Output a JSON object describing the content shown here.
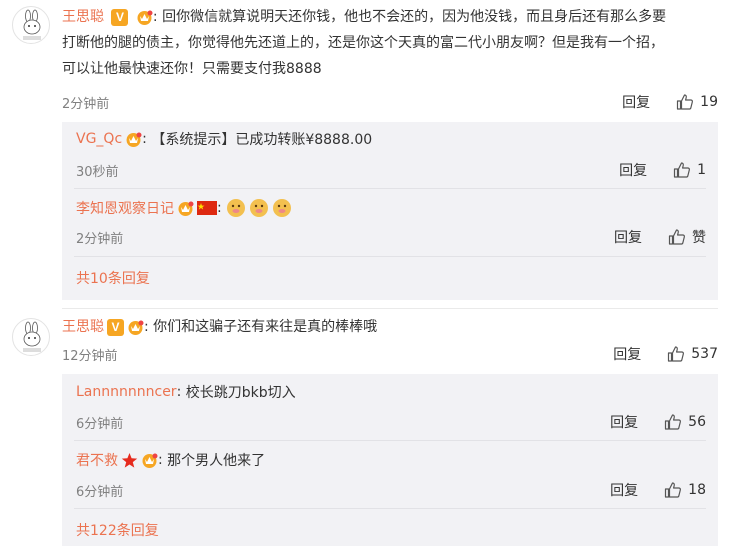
{
  "comments": [
    {
      "user": "王思聪",
      "text_line1": "回你微信就算说明天还你钱，他也不会还的，因为他没钱，而且身后还有那么多要",
      "text_line2": "打断他的腿的债主，你觉得他先还道上的，还是你这个天真的富二代小朋友啊？但是我有一个招，",
      "text_line3": "可以让他最快速还你！只需要支付我8888",
      "time": "2分钟前",
      "reply_label": "回复",
      "likes": "19",
      "replies": [
        {
          "user": "VG_Qc",
          "text": "【系统提示】已成功转账¥8888.00",
          "time": "30秒前",
          "reply_label": "回复",
          "likes": "1"
        },
        {
          "user": "李知恩观察日记",
          "text": "",
          "time": "2分钟前",
          "reply_label": "回复",
          "likes": "赞"
        }
      ],
      "more_replies": "共10条回复"
    },
    {
      "user": "王思聪",
      "text": "你们和这骗子还有来往是真的棒棒哦",
      "time": "12分钟前",
      "reply_label": "回复",
      "likes": "537",
      "replies": [
        {
          "user": "Lannnnnnncer",
          "text": "校长跳刀bkb切入",
          "time": "6分钟前",
          "reply_label": "回复",
          "likes": "56"
        },
        {
          "user": "君不救",
          "text": "那个男人他来了",
          "time": "6分钟前",
          "reply_label": "回复",
          "likes": "18"
        }
      ],
      "more_replies": "共122条回复"
    }
  ],
  "icons": {
    "avatar": "bunny-avatar-icon",
    "verified": "verified-v-badge-icon",
    "vip": "vip-crown-badge-icon",
    "like": "thumbs-up-icon",
    "flag": "china-flag-icon",
    "star": "red-star-icon",
    "emoji": "doge-emoji-icon"
  },
  "colors": {
    "username": "#eb7350",
    "reply_box": "#f2f2f5",
    "verified_badge": "#f6a623"
  },
  "verified_letter": "V"
}
